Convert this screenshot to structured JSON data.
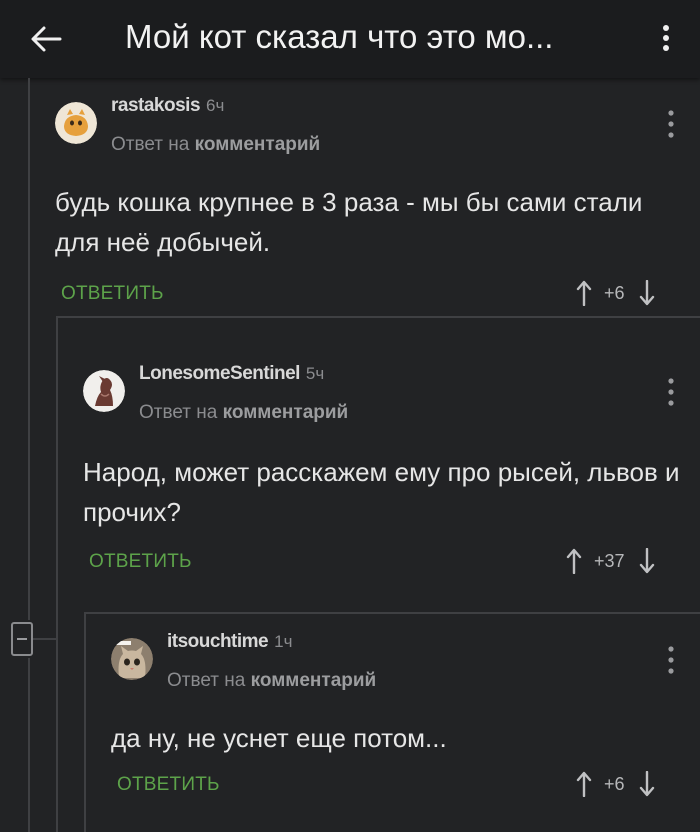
{
  "header": {
    "title": "Мой кот сказал что это мо...",
    "back_icon": "arrow-left-icon",
    "menu_icon": "more-vertical-icon"
  },
  "comments": [
    {
      "username": "rastakosis",
      "time": "6ч",
      "reply_prefix": "Ответ на",
      "reply_target": "комментарий",
      "body": "будь кошка крупнее в 3 раза - мы бы сами стали для неё добычей.",
      "reply_label": "ОТВЕТИТЬ",
      "score": "+6"
    },
    {
      "username": "LonesomeSentinel",
      "time": "5ч",
      "reply_prefix": "Ответ на",
      "reply_target": "комментарий",
      "body": "Народ, может расскажем ему про рысей, львов и прочих?",
      "reply_label": "ОТВЕТИТЬ",
      "score": "+37"
    },
    {
      "username": "itsouchtime",
      "time": "1ч",
      "reply_prefix": "Ответ на",
      "reply_target": "комментарий",
      "body": "да ну, не уснет еще потом...",
      "reply_label": "ОТВЕТИТЬ",
      "score": "+6"
    }
  ],
  "colors": {
    "background": "#222325",
    "header": "#1b1c1e",
    "accent_green": "#5da34a",
    "muted": "#8b8c8f"
  }
}
